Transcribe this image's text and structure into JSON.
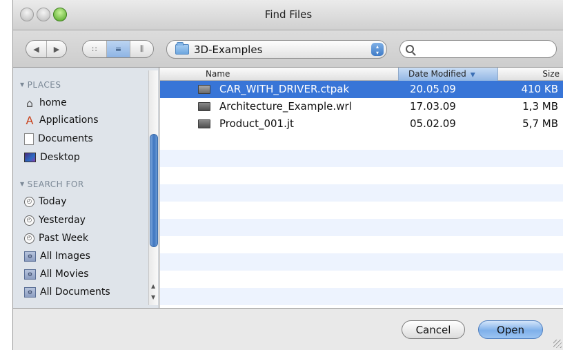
{
  "window": {
    "title": "Find Files"
  },
  "toolbar": {
    "nav": {
      "back_icon": "◀",
      "forward_icon": "▶"
    },
    "view_modes": {
      "icon_view": "∷",
      "list_view": "≡",
      "column_view": "⫼"
    },
    "path": {
      "current": "3D-Examples",
      "stepper": "▴\n▾"
    },
    "search": {
      "value": "",
      "placeholder": ""
    }
  },
  "sidebar": {
    "places_header": "PLACES",
    "places": [
      {
        "label": "home",
        "icon": "home-icon"
      },
      {
        "label": "Applications",
        "icon": "applications-icon"
      },
      {
        "label": "Documents",
        "icon": "documents-icon"
      },
      {
        "label": "Desktop",
        "icon": "desktop-icon"
      }
    ],
    "search_header": "SEARCH FOR",
    "searches": [
      {
        "label": "Today",
        "icon": "clock-icon"
      },
      {
        "label": "Yesterday",
        "icon": "clock-icon"
      },
      {
        "label": "Past Week",
        "icon": "clock-icon"
      },
      {
        "label": "All Images",
        "icon": "smart-folder-icon"
      },
      {
        "label": "All Movies",
        "icon": "smart-folder-icon"
      },
      {
        "label": "All Documents",
        "icon": "smart-folder-icon"
      }
    ]
  },
  "list": {
    "columns": {
      "name": "Name",
      "date": "Date Modified",
      "size": "Size"
    },
    "sort_indicator": "▼",
    "rows": [
      {
        "name": "CAR_WITH_DRIVER.ctpak",
        "date": "20.05.09",
        "size": "410 KB",
        "selected": true
      },
      {
        "name": "Architecture_Example.wrl",
        "date": "17.03.09",
        "size": "1,3 MB",
        "selected": false
      },
      {
        "name": "Product_001.jt",
        "date": "05.02.09",
        "size": "5,7 MB",
        "selected": false
      }
    ]
  },
  "buttons": {
    "cancel": "Cancel",
    "open": "Open"
  },
  "colors": {
    "selection": "#3875d7",
    "alt_row": "#edf3fe",
    "sidebar_bg": "#dfe4ea"
  }
}
